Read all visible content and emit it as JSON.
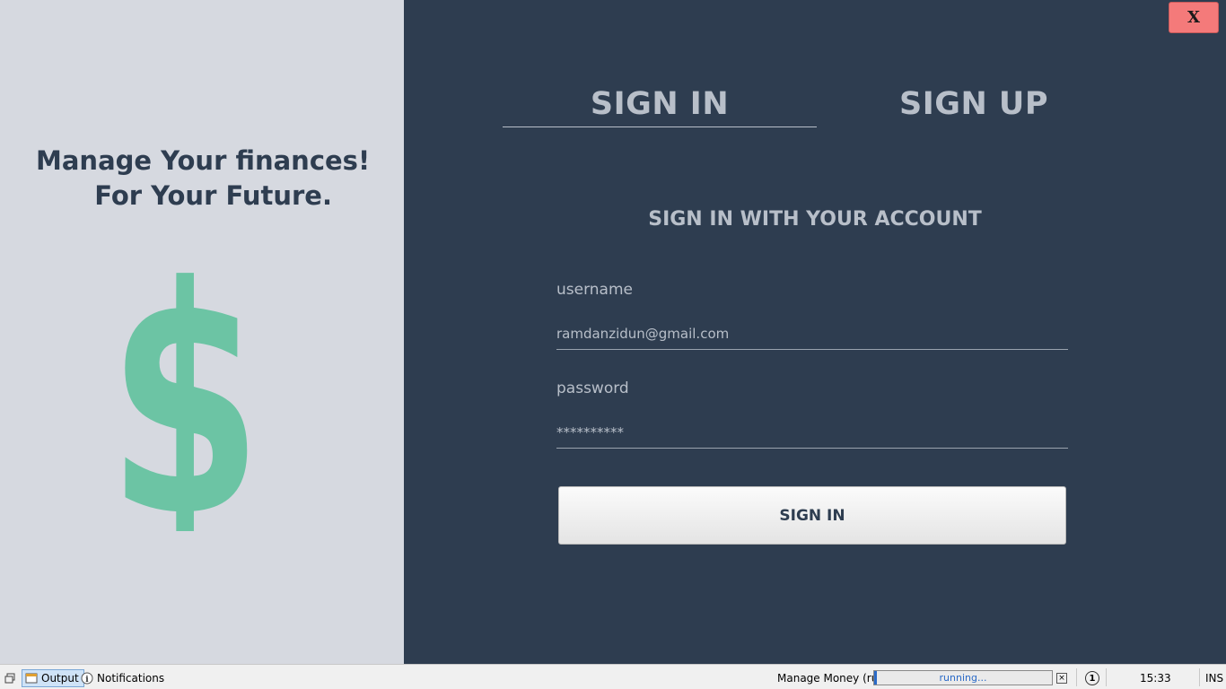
{
  "window": {
    "close_label": "X"
  },
  "left": {
    "tagline_line1": "Manage Your finances!",
    "tagline_line2": "For Your Future.",
    "icon": "dollar-sign-icon",
    "icon_color": "#6cc4a4"
  },
  "tabs": [
    {
      "label": "SIGN IN",
      "active": true
    },
    {
      "label": "SIGN UP",
      "active": false
    }
  ],
  "form": {
    "title": "SIGN IN WITH YOUR ACCOUNT",
    "username_label": "username",
    "username_value": "ramdanzidun@gmail.com",
    "password_label": "password",
    "password_value": "**********",
    "submit_label": "SIGN IN"
  },
  "statusbar": {
    "output_label": "Output",
    "notifications_label": "Notifications",
    "run_label": "Manage Money (run)",
    "progress_text": "running...",
    "badge": "1",
    "time": "15:33",
    "mode": "INS"
  },
  "colors": {
    "dark_panel": "#2e3d50",
    "light_panel": "#d6d9e0",
    "accent_green": "#6cc4a4",
    "close_button": "#f47a7a"
  }
}
